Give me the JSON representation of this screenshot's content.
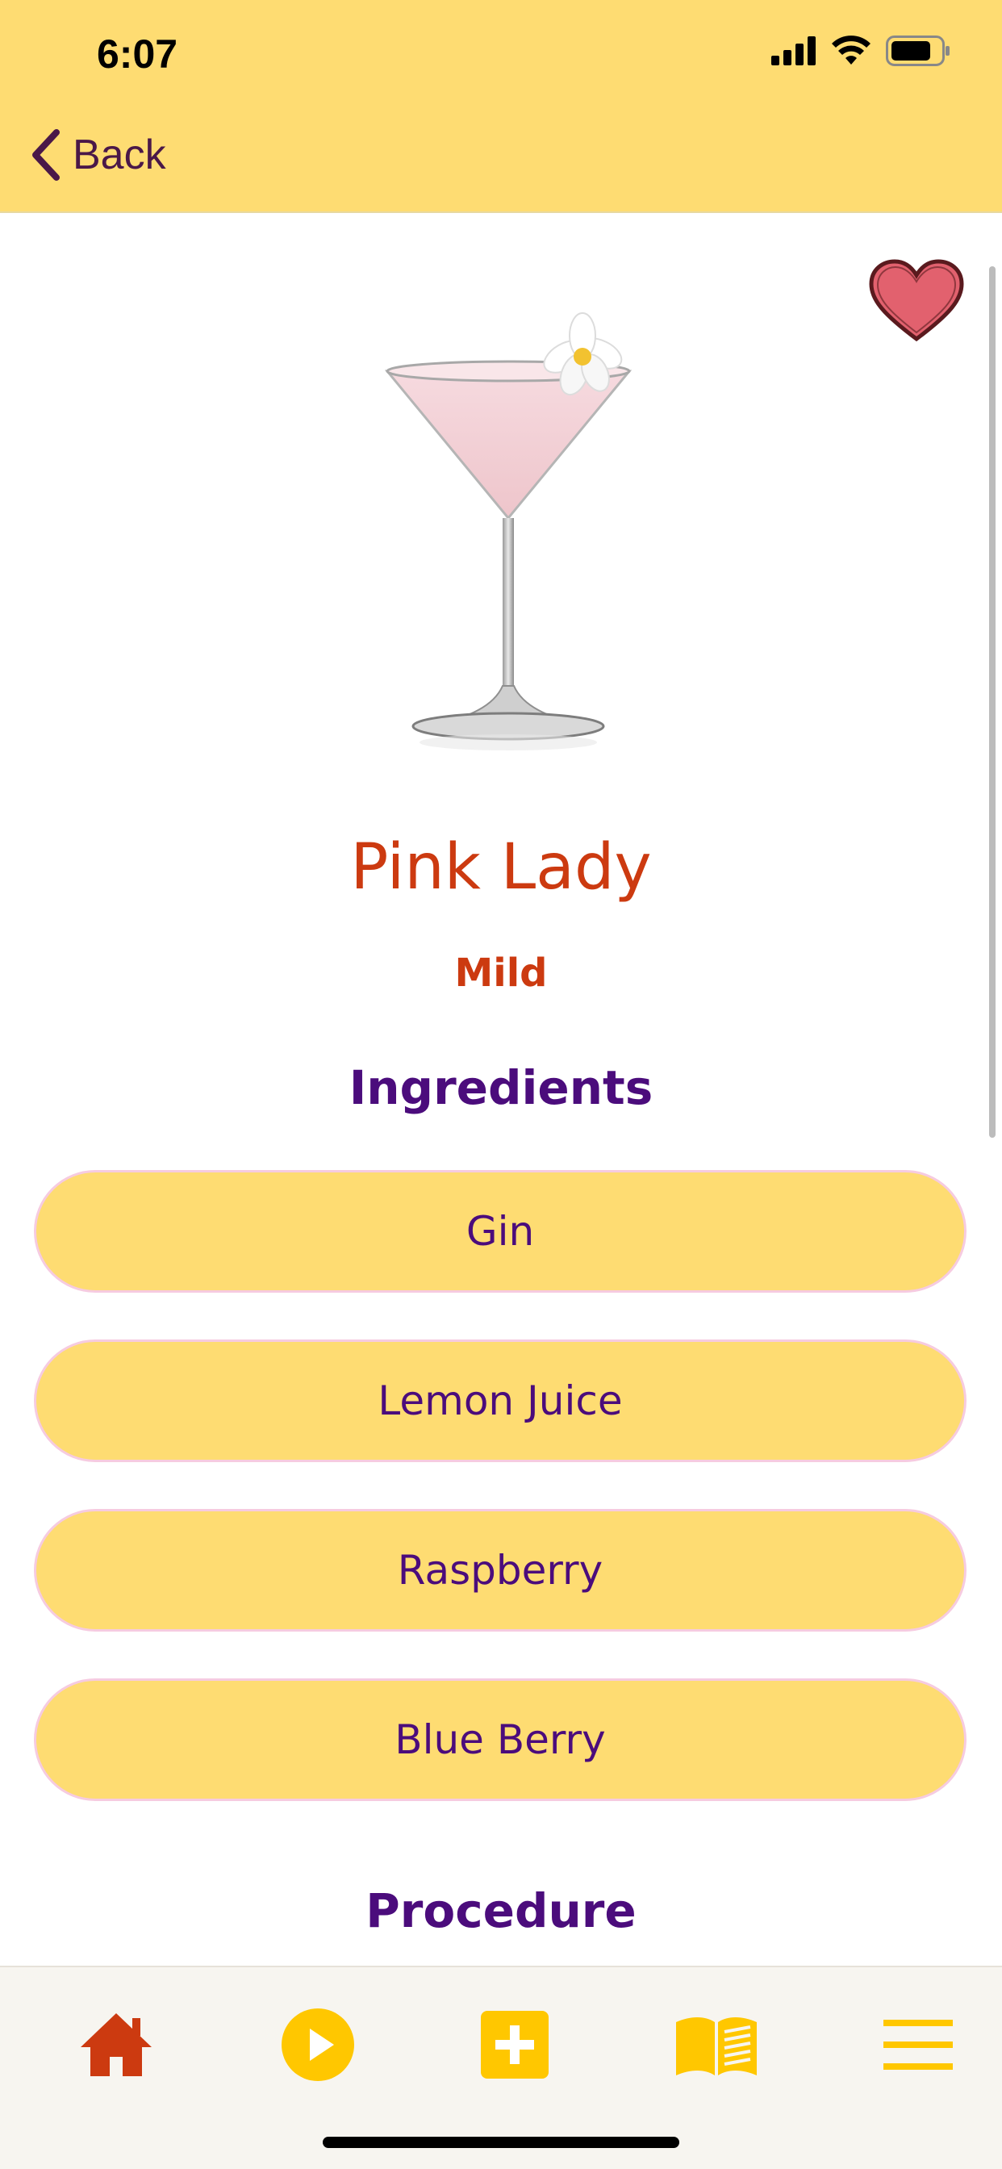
{
  "status_bar": {
    "time": "6:07"
  },
  "nav": {
    "back_label": "Back"
  },
  "drink": {
    "name": "Pink Lady",
    "strength": "Mild",
    "favorite": true
  },
  "ingredients": {
    "heading": "Ingredients",
    "items": [
      "Gin",
      "Lemon Juice",
      "Raspberry",
      "Blue Berry"
    ]
  },
  "procedure": {
    "heading": "Procedure"
  },
  "tab_bar": {
    "items": [
      "home-icon",
      "play-icon",
      "add-icon",
      "book-icon",
      "menu-icon"
    ]
  },
  "colors": {
    "header_bg": "#FEDC72",
    "title": "#CC3A10",
    "heading": "#4B0C7C",
    "heart": "#E2616E",
    "tab_home": "#CC3A10",
    "tab_accent": "#FFC700"
  }
}
